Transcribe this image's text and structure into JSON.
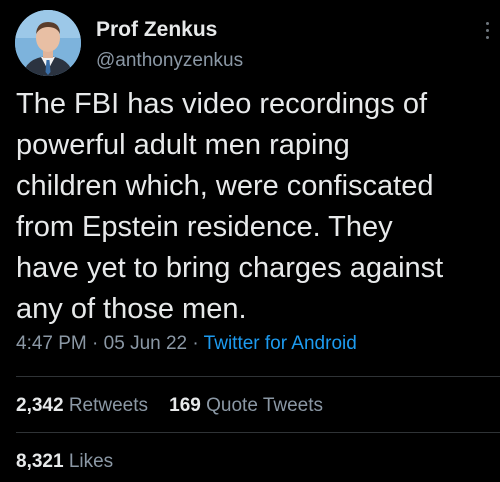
{
  "author": {
    "display_name": "Prof Zenkus",
    "handle": "@anthonyzenkus",
    "avatar_icon": "person-avatar-icon"
  },
  "tweet": {
    "lines": [
      "The FBI has video recordings of",
      "powerful adult men raping",
      "children which, were confiscated",
      "from Epstein residence. They",
      "have yet to bring charges against",
      "any of those men."
    ],
    "time": "4:47 PM",
    "date": "05 Jun 22",
    "separator": "·",
    "source": "Twitter for Android"
  },
  "stats": {
    "retweets_count": "2,342",
    "retweets_label": "Retweets",
    "quotes_count": "169",
    "quotes_label": "Quote Tweets",
    "likes_count": "8,321",
    "likes_label": "Likes"
  },
  "colors": {
    "background": "#000000",
    "text": "#e7e9ea",
    "secondary": "#8b98a5",
    "link": "#1d9bf0",
    "divider": "#2f3336"
  }
}
